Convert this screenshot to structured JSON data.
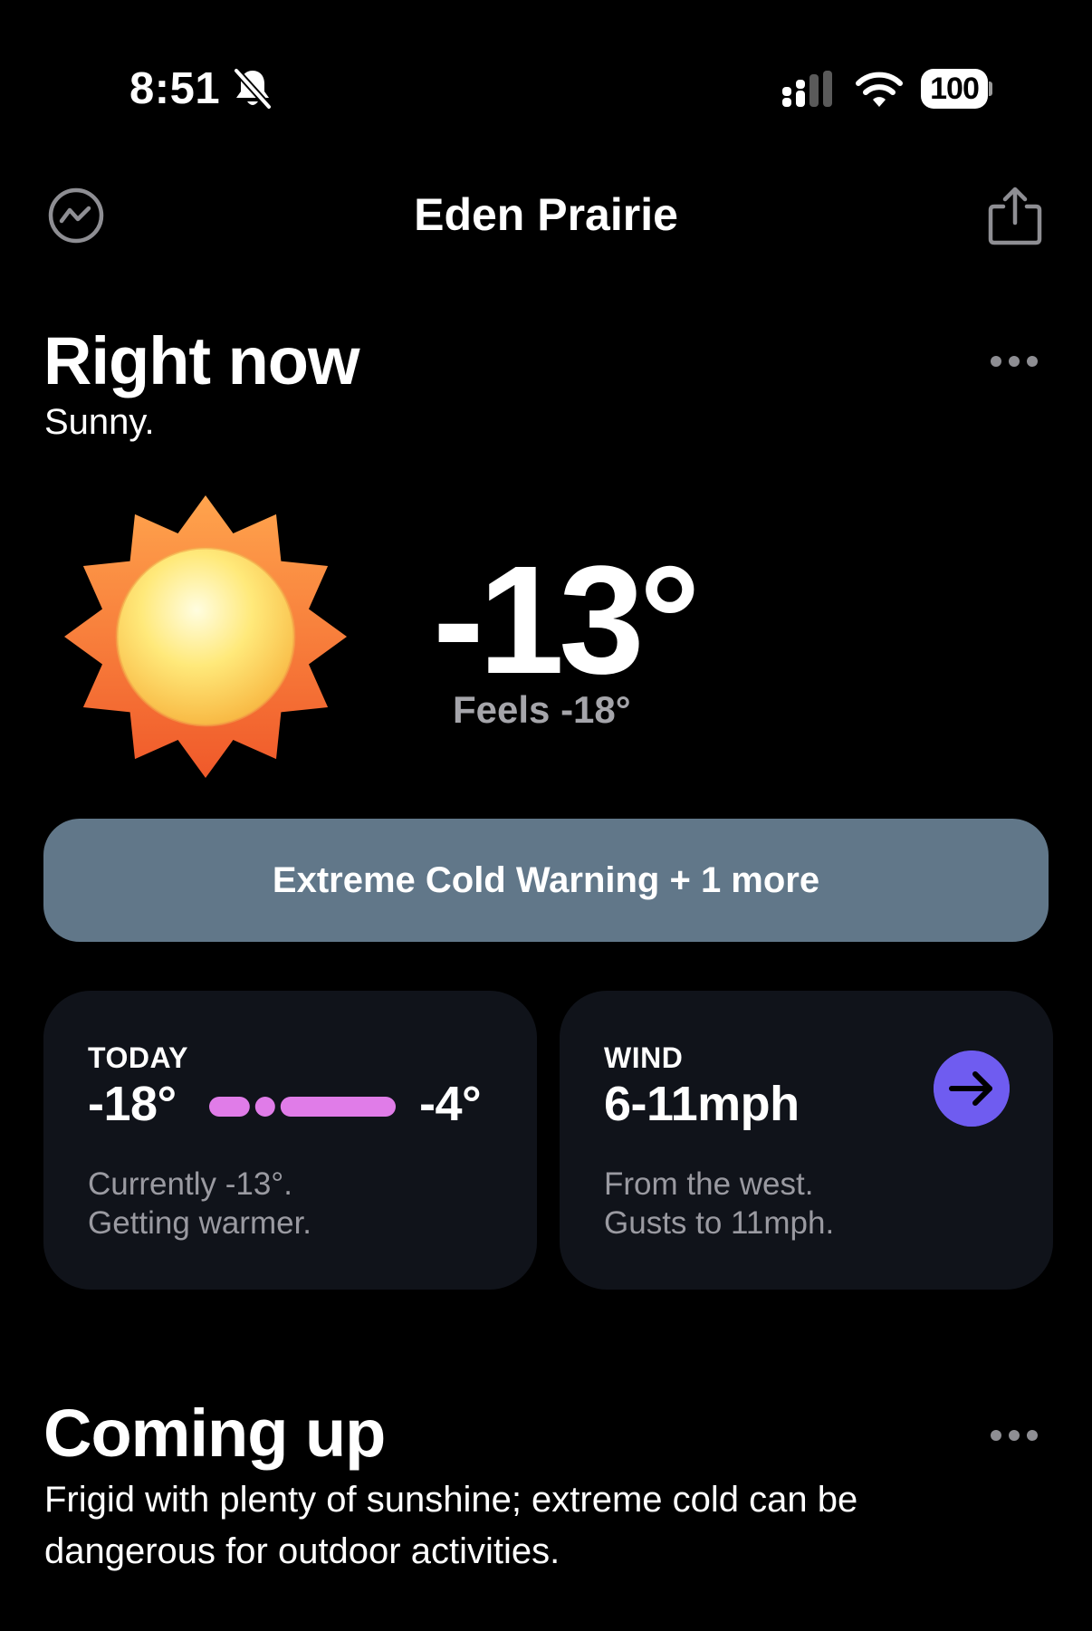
{
  "status_bar": {
    "time": "8:51",
    "silent_icon": "bell-slash-icon",
    "signal_icon": "cellular-signal-icon",
    "wifi_icon": "wifi-icon",
    "battery_level": "100"
  },
  "header": {
    "left_icon": "chart-trend-icon",
    "city": "Eden Prairie",
    "right_icon": "share-icon"
  },
  "right_now": {
    "title": "Right now",
    "summary": "Sunny.",
    "condition_icon": "sun-icon",
    "temperature": "-13°",
    "feels_like": "Feels -18°",
    "more_icon": "ellipsis-icon"
  },
  "alert": {
    "label": "Extreme Cold Warning + 1 more",
    "color": "#617789"
  },
  "today_card": {
    "label": "TODAY",
    "low": "-18°",
    "high": "-4°",
    "current_position": 0.3,
    "range_color": "#e07ce8",
    "description_line1": "Currently -13°.",
    "description_line2": "Getting warmer."
  },
  "wind_card": {
    "label": "WIND",
    "speed": "6-11mph",
    "direction_icon": "arrow-right-icon",
    "accent_color": "#6f5cf0",
    "description_line1": "From the west.",
    "description_line2": "Gusts to 11mph."
  },
  "coming_up": {
    "title": "Coming up",
    "description": "Frigid with plenty of sunshine; extreme cold can be dangerous for outdoor activities.",
    "more_icon": "ellipsis-icon"
  }
}
